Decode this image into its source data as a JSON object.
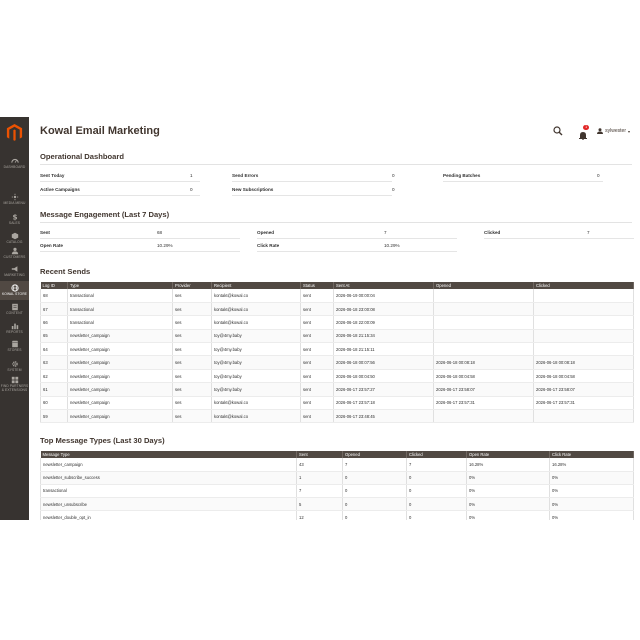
{
  "app": {
    "title": "Kowal Email Marketing"
  },
  "sidebar": {
    "items": [
      {
        "label": "DASHBOARD",
        "icon": "dashboard-icon"
      },
      {
        "label": "MEDIA MENU",
        "icon": "media-icon"
      },
      {
        "label": "SALES",
        "icon": "dollar-icon"
      },
      {
        "label": "CATALOG",
        "icon": "cube-icon"
      },
      {
        "label": "CUSTOMERS",
        "icon": "customers-icon"
      },
      {
        "label": "MARKETING",
        "icon": "megaphone-icon"
      },
      {
        "label": "KOWAL STORE",
        "icon": "globe-icon"
      },
      {
        "label": "CONTENT",
        "icon": "content-icon"
      },
      {
        "label": "REPORTS",
        "icon": "reports-icon"
      },
      {
        "label": "STORES",
        "icon": "stores-icon"
      },
      {
        "label": "SYSTEM",
        "icon": "gear-icon"
      },
      {
        "label": "FIND PARTNERS & EXTENSIONS",
        "icon": "partners-icon"
      }
    ]
  },
  "header": {
    "notifications_count": "1",
    "user_name": "sylwester"
  },
  "operational": {
    "title": "Operational Dashboard",
    "items": [
      {
        "label": "Sent Today",
        "value": "1"
      },
      {
        "label": "Send Errors",
        "value": "0"
      },
      {
        "label": "Pending Batches",
        "value": "0"
      },
      {
        "label": "Active Campaigns",
        "value": "0"
      },
      {
        "label": "New Subscriptions",
        "value": "0"
      }
    ]
  },
  "engagement": {
    "title": "Message Engagement (Last 7 Days)",
    "items": [
      {
        "label": "Sent",
        "value": "68"
      },
      {
        "label": "Opened",
        "value": "7"
      },
      {
        "label": "Clicked",
        "value": "7"
      },
      {
        "label": "Open Rate",
        "value": "10.29%"
      },
      {
        "label": "Click Rate",
        "value": "10.29%"
      }
    ]
  },
  "recent": {
    "title": "Recent Sends",
    "headers": [
      "Log ID",
      "Type",
      "Provider",
      "Recipient",
      "Status",
      "Sent At",
      "Opened",
      "Clicked"
    ],
    "rows": [
      [
        "68",
        "transactional",
        "ses",
        "kontakt@kowal.co",
        "sent",
        "2026-06-19 00:00:04",
        "",
        ""
      ],
      [
        "67",
        "transactional",
        "ses",
        "kontakt@kowal.co",
        "sent",
        "2026-06-18 23:00:08",
        "",
        ""
      ],
      [
        "66",
        "transactional",
        "ses",
        "kontakt@kowal.co",
        "sent",
        "2026-06-18 22:00:09",
        "",
        ""
      ],
      [
        "65",
        "newsletter_campaign",
        "ses",
        "toy@4my.baby",
        "sent",
        "2026-06-18 21:15:34",
        "",
        ""
      ],
      [
        "64",
        "newsletter_campaign",
        "ses",
        "toy@4my.baby",
        "sent",
        "2026-06-18 21:15:11",
        "",
        ""
      ],
      [
        "63",
        "newsletter_campaign",
        "ses",
        "toy@4my.baby",
        "sent",
        "2026-06-18 00:07:56",
        "2026-06-18 00:08:18",
        "2026-06-18 00:08:18"
      ],
      [
        "62",
        "newsletter_campaign",
        "ses",
        "toy@4my.baby",
        "sent",
        "2026-06-18 00:04:50",
        "2026-06-18 00:04:58",
        "2026-06-18 00:04:58"
      ],
      [
        "61",
        "newsletter_campaign",
        "ses",
        "toy@4my.baby",
        "sent",
        "2026-06-17 23:57:27",
        "2026-06-17 23:58:07",
        "2026-06-17 23:58:07"
      ],
      [
        "60",
        "newsletter_campaign",
        "ses",
        "kontakt@kowal.co",
        "sent",
        "2026-06-17 23:57:18",
        "2026-06-17 23:57:31",
        "2026-06-17 23:57:31"
      ],
      [
        "59",
        "newsletter_campaign",
        "ses",
        "kontakt@kowal.co",
        "sent",
        "2026-06-17 23:48:45",
        "",
        ""
      ]
    ]
  },
  "types": {
    "title": "Top Message Types (Last 30 Days)",
    "headers": [
      "Message Type",
      "Sent",
      "Opened",
      "Clicked",
      "Open Rate",
      "Click Rate"
    ],
    "rows": [
      [
        "newsletter_campaign",
        "43",
        "7",
        "7",
        "16.28%",
        "16.28%"
      ],
      [
        "newsletter_subscribe_success",
        "1",
        "0",
        "0",
        "0%",
        "0%"
      ],
      [
        "transactional",
        "7",
        "0",
        "0",
        "0%",
        "0%"
      ],
      [
        "newsletter_unsubscribe",
        "5",
        "0",
        "0",
        "0%",
        "0%"
      ],
      [
        "newsletter_double_opt_in",
        "12",
        "0",
        "0",
        "0%",
        "0%"
      ]
    ]
  },
  "colors": {
    "sidebar_bg": "#373330",
    "header_bg": "#514943",
    "accent": "#eb5202",
    "badge": "#e22626"
  }
}
